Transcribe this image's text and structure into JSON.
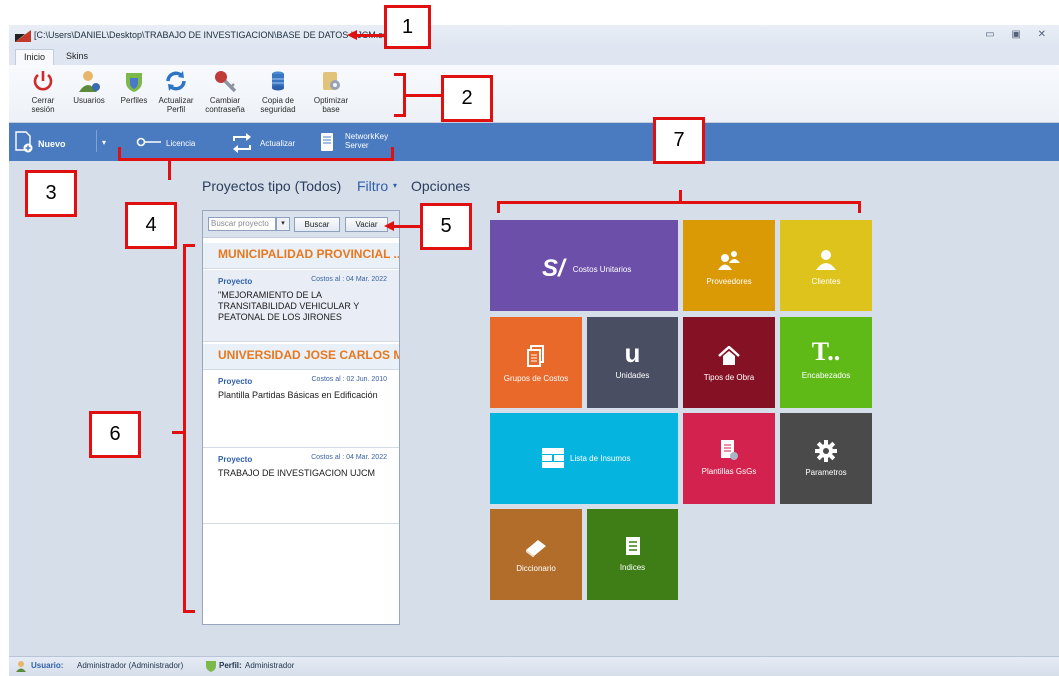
{
  "window": {
    "path": "[C:\\Users\\DANIEL\\Desktop\\TRABAJO DE INVESTIGACION\\BASE DE DATOS UJCM.sqlite]",
    "controls": [
      "minimize",
      "restore",
      "close"
    ]
  },
  "tabs": [
    "Inicio",
    "Skins"
  ],
  "ribbon": [
    {
      "label": "Cerrar\nsesión",
      "icon": "power-icon"
    },
    {
      "label": "Usuarios",
      "icon": "users-icon"
    },
    {
      "label": "Perfiles",
      "icon": "profiles-icon"
    },
    {
      "label": "Actualizar\nPerfil",
      "icon": "refresh-icon"
    },
    {
      "label": "Cambiar\ncontraseña",
      "icon": "key-icon"
    },
    {
      "label": "Copia de\nseguridad",
      "icon": "database-icon"
    },
    {
      "label": "Optimizar\nbase",
      "icon": "optimize-icon"
    }
  ],
  "toolbar": {
    "nuevo": "Nuevo",
    "licencia": "Licencia",
    "actualizar": "Actualizar",
    "networkkey": "NetworkKey\nServer"
  },
  "center": {
    "title": "Proyectos tipo (Todos)",
    "filtro": "Filtro",
    "opciones": "Opciones",
    "search_placeholder": "Buscar proyecto",
    "buscar": "Buscar",
    "vaciar": "Vaciar"
  },
  "projects": [
    {
      "group": "MUNICIPALIDAD PROVINCIAL ...",
      "label": "Proyecto",
      "date": "Costos al : 04 Mar. 2022",
      "title": "\"MEJORAMIENTO  DE  LA TRANSITABILIDAD  VEHICULAR Y PEATONAL DE LOS JIRONES"
    },
    {
      "group": "UNIVERSIDAD JOSE CARLOS M...",
      "label": "Proyecto",
      "date": "Costos al : 02 Jun. 2010",
      "title": "Plantilla Partidas Básicas en Edificación"
    },
    {
      "group": "",
      "label": "Proyecto",
      "date": "Costos al : 04 Mar. 2022",
      "title": "TRABAJO DE INVESTIGACION UJCM"
    }
  ],
  "tiles": [
    {
      "name": "costos-unitarios",
      "label": "Costos Unitarios",
      "color": "#6b4fa8"
    },
    {
      "name": "proveedores",
      "label": "Proveedores",
      "color": "#d99a06"
    },
    {
      "name": "clientes",
      "label": "Clientes",
      "color": "#ddc31b"
    },
    {
      "name": "grupos-de-costos",
      "label": "Grupos de Costos",
      "color": "#e8692a"
    },
    {
      "name": "unidades",
      "label": "Unidades",
      "color": "#4a4e63"
    },
    {
      "name": "tipos-de-obra",
      "label": "Tipos de Obra",
      "color": "#841224"
    },
    {
      "name": "encabezados",
      "label": "Encabezados",
      "color": "#5fba18"
    },
    {
      "name": "lista-de-insumos",
      "label": "Lista de Insumos",
      "color": "#06b4e0"
    },
    {
      "name": "plantillas-gsgs",
      "label": "Plantillas GsGs",
      "color": "#d3224e"
    },
    {
      "name": "parametros",
      "label": "Parametros",
      "color": "#4a4a4a"
    },
    {
      "name": "diccionario",
      "label": "Diccionario",
      "color": "#b36d2a"
    },
    {
      "name": "indices",
      "label": "Indices",
      "color": "#3f7e16"
    }
  ],
  "status": {
    "usuario_label": "Usuario:",
    "usuario_value": "Administrador (Administrador)",
    "perfil_label": "Perfil:",
    "perfil_value": "Administrador"
  },
  "callouts": [
    "1",
    "2",
    "3",
    "4",
    "5",
    "6",
    "7"
  ]
}
